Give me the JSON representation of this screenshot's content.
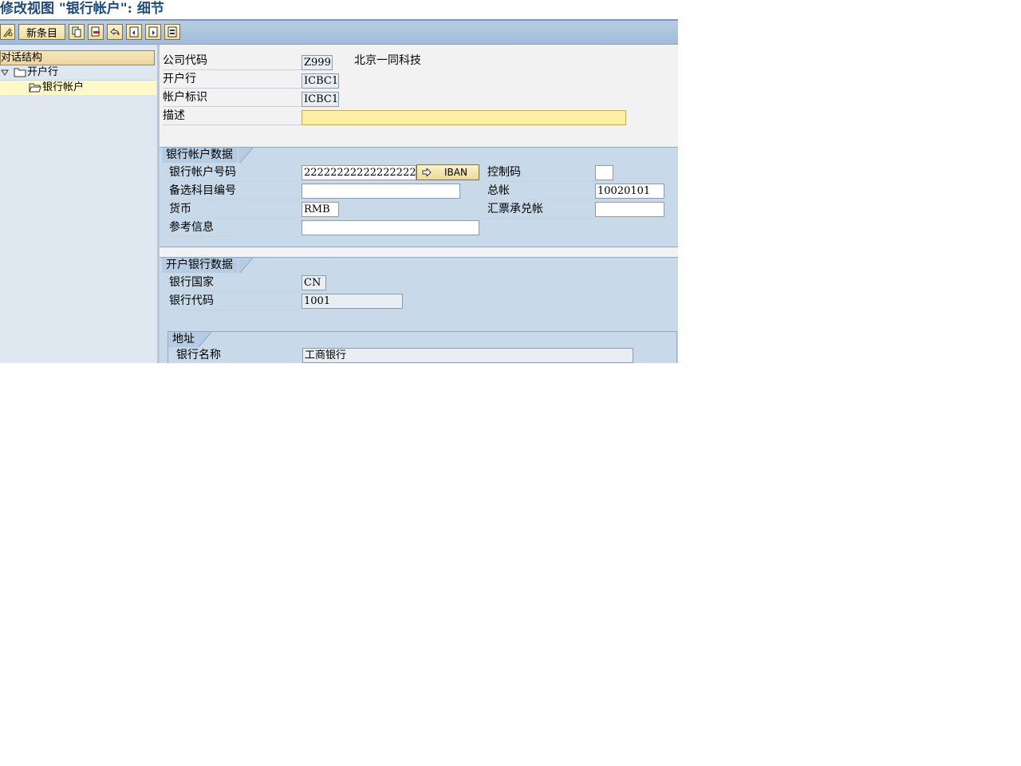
{
  "title": "修改视图 \"银行帐户\": 细节",
  "toolbar": {
    "new_entries_label": "新条目",
    "icons": [
      "pencil-glasses-icon",
      "copy-icon",
      "delete-icon",
      "undo-icon",
      "prev-entry-icon",
      "next-entry-icon",
      "select-icon"
    ]
  },
  "tree": {
    "header": "对话结构",
    "items": [
      {
        "label": "开户行",
        "expanded": true
      },
      {
        "label": "银行帐户",
        "selected": true
      }
    ]
  },
  "header_fields": {
    "company_code": {
      "label": "公司代码",
      "value": "Z999",
      "name": "北京一同科技"
    },
    "house_bank": {
      "label": "开户行",
      "value": "ICBC1"
    },
    "account_id": {
      "label": "帐户标识",
      "value": "ICBC1"
    },
    "description": {
      "label": "描述",
      "value": ""
    }
  },
  "bank_account_data": {
    "title": "银行帐户数据",
    "account_number": {
      "label": "银行帐户号码",
      "value": "22222222222222222222"
    },
    "iban_button": "IBAN",
    "alt_account": {
      "label": "备选科目编号",
      "value": ""
    },
    "currency": {
      "label": "货币",
      "value": "RMB"
    },
    "reference": {
      "label": "参考信息",
      "value": ""
    },
    "control_key": {
      "label": "控制码",
      "value": ""
    },
    "gl_account": {
      "label": "总帐",
      "value": "10020101"
    },
    "bill_account": {
      "label": "汇票承兑帐",
      "value": ""
    }
  },
  "house_bank_data": {
    "title": "开户银行数据",
    "bank_country": {
      "label": "银行国家",
      "value": "CN"
    },
    "bank_key": {
      "label": "银行代码",
      "value": "1001"
    },
    "address": {
      "title": "地址",
      "bank_name": {
        "label": "银行名称",
        "value": "工商银行"
      }
    }
  }
}
